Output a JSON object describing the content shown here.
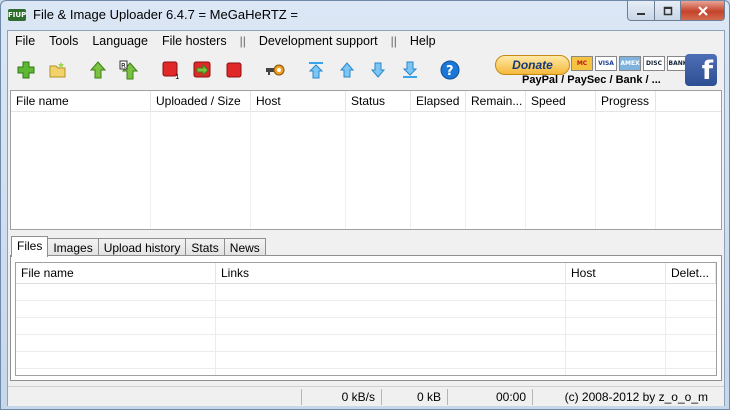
{
  "window": {
    "app_icon_text": "FIUP",
    "title": "File & Image Uploader 6.4.7  = MeGaHeRTZ ="
  },
  "menu": {
    "items": [
      "File",
      "Tools",
      "Language",
      "File hosters",
      "Development support",
      "Help"
    ],
    "separator": "||"
  },
  "toolbar": {
    "donate_label": "Donate",
    "donate_caption": "PayPal / PaySec / Bank / ...",
    "cards": [
      "MC",
      "VISA",
      "AMEX",
      "DISC",
      "BANK"
    ],
    "facebook_label": "f"
  },
  "upload_list": {
    "columns": [
      "File name",
      "Uploaded / Size",
      "Host",
      "Status",
      "Elapsed",
      "Remain...",
      "Speed",
      "Progress"
    ]
  },
  "tabs": [
    "Files",
    "Images",
    "Upload history",
    "Stats",
    "News"
  ],
  "files_table": {
    "columns": [
      "File name",
      "Links",
      "Host",
      "Delet..."
    ]
  },
  "statusbar": {
    "speed": "0 kB/s",
    "size": "0 kB",
    "time": "00:00",
    "copyright": "(c) 2008-2012 by z_o_o_m"
  },
  "colors": {
    "accent_green": "#5fb832",
    "stop_red": "#e02828",
    "arrow_blue": "#3aa4ea",
    "help_blue": "#1b78d6",
    "facebook_blue": "#3b5998"
  }
}
